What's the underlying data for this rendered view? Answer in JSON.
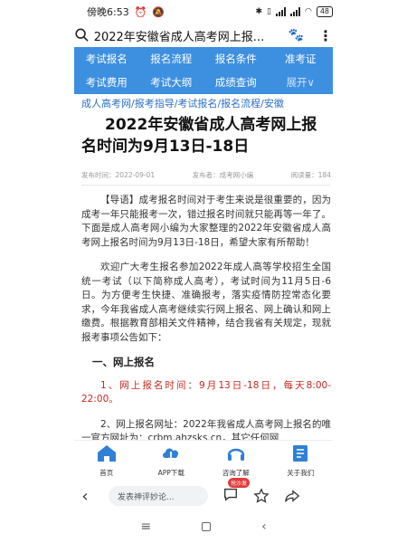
{
  "status_bar": {
    "time": "傍晚6:53",
    "left_icons": [
      "alarm-icon",
      "mute-icon"
    ],
    "right_icons": [
      "bluetooth-icon",
      "vibrate-icon",
      "signal-icon",
      "wifi-icon"
    ],
    "battery": "48"
  },
  "browser": {
    "address_text": "2022年安徽省成人高考网上报...",
    "icons": [
      "search-icon",
      "paw-icon",
      "menu-dots-icon"
    ]
  },
  "nav": {
    "row1": [
      "考试报名",
      "报名流程",
      "报名条件",
      "准考证"
    ],
    "row2": [
      "考试费用",
      "考试大纲",
      "成绩查询",
      "展开∨"
    ]
  },
  "breadcrumb": [
    "成人高考网",
    "报考指导",
    "考试报名",
    "报名流程",
    "安徽"
  ],
  "article": {
    "title": "2022年安徽省成人高考网上报名时间为9月13日-18日",
    "publish_time": "发布时间：2022-09-01",
    "publisher": "发布者：成考网小编",
    "read_count": "阅读量：184",
    "intro": "【导语】成考报名时间对于考生来说是很重要的，因为成考一年只能报考一次，错过报名时间就只能再等一年了。下面是成人高考网小编为大家整理的2022年安徽省成人高考网上报名时间为9月13日-18日，希望大家有所帮助！",
    "para1": "欢迎广大考生报名参加2022年成人高等学校招生全国统一考试（以下简称成人高考），考试时间为11月5日-6日。为方便考生快捷、准确报考，落实疫情防控常态化要求，今年我省成人高考继续实行网上报名、网上确认和网上缴费。根据教育部相关文件精神，结合我省有关规定，现就报考事项公告如下：",
    "section1": "一、网上报名",
    "item1": "1、网上报名时间：9月13日-18日，每天8:00-22:00。",
    "item2": "2、网上报名网址：2022年我省成人高考网上报名的唯一官方网址为：crbm.ahzsks.cn，其它任何网"
  },
  "tabbar": [
    {
      "label": "首页",
      "icon": "home-icon"
    },
    {
      "label": "APP下载",
      "icon": "download-cloud-icon"
    },
    {
      "label": "咨询了解",
      "icon": "consult-headset-icon"
    },
    {
      "label": "关于我们",
      "icon": "about-book-icon"
    }
  ],
  "browser_bottom": {
    "comment_placeholder": "发表神评妙论...",
    "comment_badge": "抢沙发",
    "icons": [
      "back-arrow-icon",
      "comment-icon",
      "star-icon",
      "share-icon"
    ]
  },
  "android_nav": [
    "menu-icon",
    "home-square-icon",
    "back-icon"
  ],
  "colors": {
    "nav_bg": "#3d8fe0",
    "link": "#2a6fc9",
    "highlight_red": "#c8281e",
    "badge_red": "#e23b3b"
  }
}
